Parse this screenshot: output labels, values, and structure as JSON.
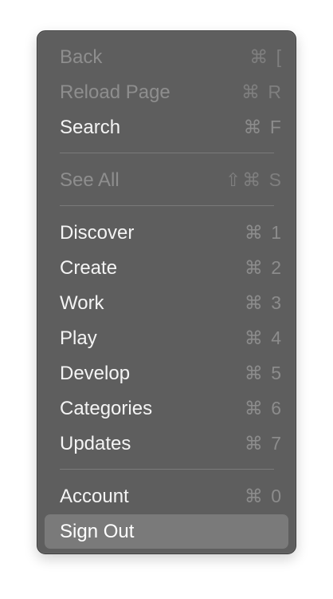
{
  "menu": {
    "items": [
      {
        "label": "Back",
        "shortcut": "⌘ ["
      },
      {
        "label": "Reload Page",
        "shortcut": "⌘ R"
      },
      {
        "label": "Search",
        "shortcut": "⌘ F"
      },
      {
        "label": "See All",
        "shortcut": "⇧⌘ S"
      },
      {
        "label": "Discover",
        "shortcut": "⌘ 1"
      },
      {
        "label": "Create",
        "shortcut": "⌘ 2"
      },
      {
        "label": "Work",
        "shortcut": "⌘ 3"
      },
      {
        "label": "Play",
        "shortcut": "⌘ 4"
      },
      {
        "label": "Develop",
        "shortcut": "⌘ 5"
      },
      {
        "label": "Categories",
        "shortcut": "⌘ 6"
      },
      {
        "label": "Updates",
        "shortcut": "⌘ 7"
      },
      {
        "label": "Account",
        "shortcut": "⌘ 0"
      },
      {
        "label": "Sign Out",
        "shortcut": ""
      }
    ]
  }
}
